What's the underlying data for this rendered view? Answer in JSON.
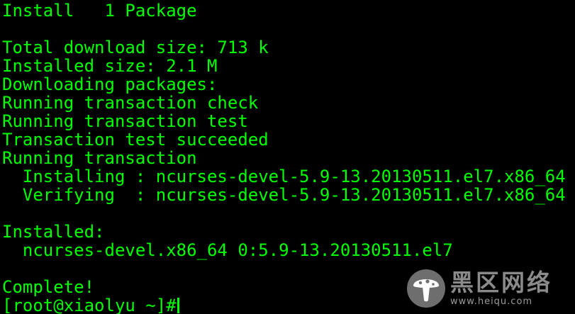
{
  "terminal": {
    "text_color": "#00ff00",
    "background_color": "#000000",
    "lines": [
      "Install   1 Package",
      "",
      "Total download size: 713 k",
      "Installed size: 2.1 M",
      "Downloading packages:",
      "Running transaction check",
      "Running transaction test",
      "Transaction test succeeded",
      "Running transaction",
      "  Installing : ncurses-devel-5.9-13.20130511.el7.x86_64",
      "  Verifying  : ncurses-devel-5.9-13.20130511.el7.x86_64",
      "",
      "Installed:",
      "  ncurses-devel.x86_64 0:5.9-13.20130511.el7",
      "",
      "Complete!"
    ],
    "prompt": "[root@xiaolyu ~]#"
  },
  "watermark": {
    "logo_icon": "mushroom-logo-icon",
    "name": "黑区网络",
    "url": "www.heiqu.com"
  }
}
